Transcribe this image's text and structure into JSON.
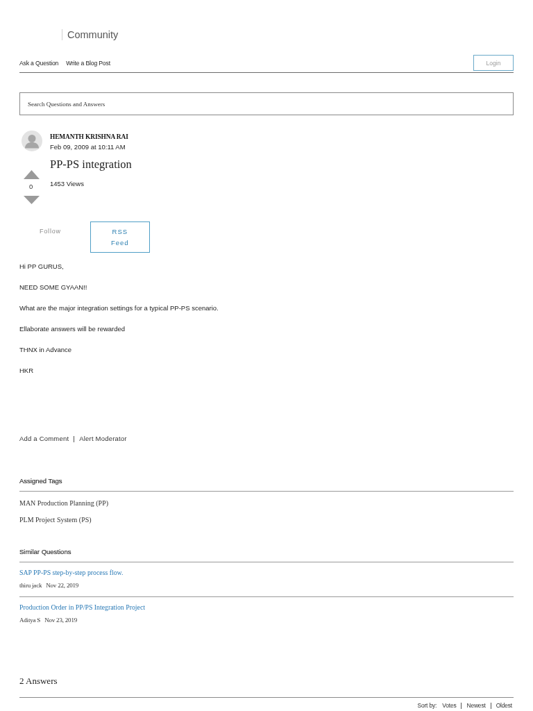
{
  "header": {
    "site_title": "Community"
  },
  "nav": {
    "links": [
      "Ask a Question",
      "Write a Blog Post"
    ],
    "login": "Login"
  },
  "search": {
    "placeholder": "Search Questions and Answers"
  },
  "question": {
    "author": "HEMANTH KRISHNA RAI",
    "date": "Feb 09, 2009 at 10:11 AM",
    "title": "PP-PS integration",
    "votes": "0",
    "views": "1453 Views",
    "follow": "Follow",
    "rss": "RSS Feed",
    "body": [
      "Hi PP GURUS,",
      "NEED SOME GYAAN!!",
      "What are the major integration settings for a typical PP-PS scenario.",
      "Ellaborate answers will be rewarded",
      "THNX in Advance",
      "HKR"
    ],
    "actions": [
      "Add a Comment",
      "Alert Moderator"
    ]
  },
  "assigned_tags": {
    "heading": "Assigned Tags",
    "tags": [
      "MAN Production Planning (PP)",
      "PLM Project System (PS)"
    ]
  },
  "similar_questions": {
    "heading": "Similar Questions",
    "items": [
      {
        "title": "SAP PP-PS step-by-step process flow.",
        "author": "thiru jack",
        "date": "Nov 22, 2019"
      },
      {
        "title": "Production Order in PP/PS Integration Project",
        "author": "Aditya S",
        "date": "Nov 23, 2019"
      }
    ]
  },
  "answers": {
    "heading": "2 Answers",
    "sort_label": "Sort by:",
    "sort_options": [
      "Votes",
      "Newest",
      "Oldest"
    ]
  }
}
